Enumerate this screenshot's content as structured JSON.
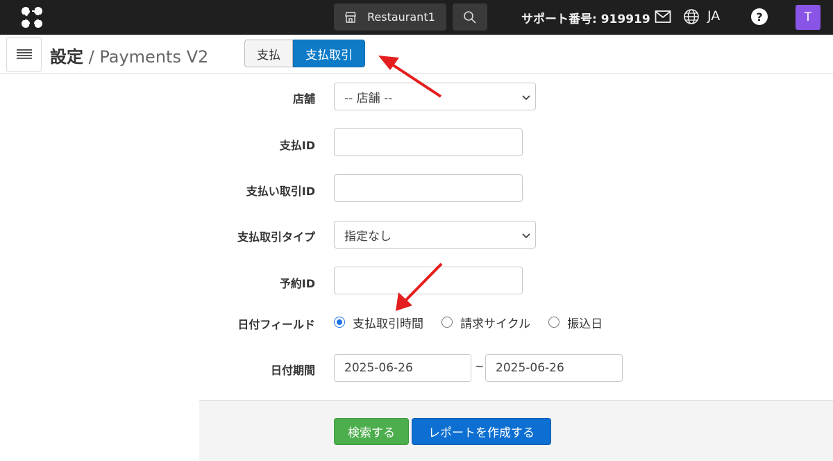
{
  "topbar": {
    "store_name": "Restaurant1",
    "support_text": "サポート番号: 919919",
    "language": "JA",
    "help_label": "?",
    "avatar_letter": "T"
  },
  "header": {
    "title_main": "設定",
    "title_separator": "/",
    "title_sub": "Payments V2",
    "tabs": [
      {
        "label": "支払",
        "active": false
      },
      {
        "label": "支払取引",
        "active": true
      }
    ]
  },
  "form": {
    "store": {
      "label": "店舗",
      "value": "-- 店舗 --"
    },
    "payment_id": {
      "label": "支払ID",
      "value": ""
    },
    "payment_transaction_id": {
      "label": "支払い取引ID",
      "value": ""
    },
    "transaction_type": {
      "label": "支払取引タイプ",
      "value": "指定なし"
    },
    "reservation_id": {
      "label": "予約ID",
      "value": ""
    },
    "date_field": {
      "label": "日付フィールド",
      "options": [
        {
          "label": "支払取引時間",
          "checked": true
        },
        {
          "label": "請求サイクル",
          "checked": false
        },
        {
          "label": "振込日",
          "checked": false
        }
      ]
    },
    "date_range": {
      "label": "日付期間",
      "from": "2025-06-26",
      "separator": "~",
      "to": "2025-06-26"
    }
  },
  "actions": {
    "search_label": "検索する",
    "report_label": "レポートを作成する"
  },
  "colors": {
    "topbar_bg": "#1f1f1f",
    "tab_active": "#0d7bc7",
    "search_button": "#4cae4c",
    "report_button": "#0d6fd1",
    "avatar": "#8a55e6",
    "annotation_arrow": "#e41e1e"
  }
}
